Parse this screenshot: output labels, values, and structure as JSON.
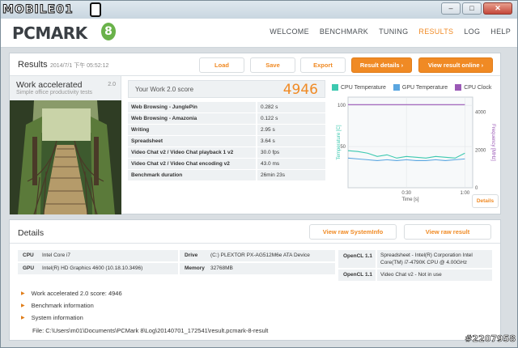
{
  "watermark_top": "MOBILE01",
  "watermark_bottom": "#2207958",
  "window": {
    "min": "–",
    "max": "□",
    "close": "✕"
  },
  "header": {
    "logo": "PCMARK",
    "logo_badge": "8",
    "nav": [
      "WELCOME",
      "BENCHMARK",
      "TUNING",
      "RESULTS",
      "LOG",
      "HELP"
    ],
    "active_nav": "RESULTS"
  },
  "results": {
    "title": "Results",
    "date": "2014/7/1 下午 05:52:12",
    "buttons": {
      "load": "Load",
      "save": "Save",
      "export": "Export",
      "details": "Result details",
      "online": "View result online"
    },
    "work": {
      "title": "Work accelerated",
      "version": "2.0",
      "subtitle": "Simple office productivity tests"
    },
    "score_label": "Your Work 2.0 score",
    "score": "4946",
    "rows": [
      {
        "k": "Web Browsing - JunglePin",
        "v": "0.282 s"
      },
      {
        "k": "Web Browsing - Amazonia",
        "v": "0.122 s"
      },
      {
        "k": "Writing",
        "v": "2.95 s"
      },
      {
        "k": "Spreadsheet",
        "v": "3.64 s"
      },
      {
        "k": "Video Chat v2 / Video Chat playback 1 v2",
        "v": "30.0 fps"
      },
      {
        "k": "Video Chat v2 / Video Chat encoding v2",
        "v": "43.0 ms"
      },
      {
        "k": "Benchmark duration",
        "v": "26min 23s"
      }
    ],
    "details_small": "Details"
  },
  "chart_data": {
    "type": "line",
    "legend": [
      "CPU Temperature",
      "GPU Temperature",
      "CPU Clock"
    ],
    "ylabel_left": "Temperature [C]",
    "ylabel_right": "Frequency [MHz]",
    "xlabel": "Time [s]",
    "x_ticks": [
      "0:30",
      "1:00"
    ],
    "y_left_ticks": [
      "100",
      "50"
    ],
    "y_right_ticks": [
      "4000",
      "2000",
      "0"
    ],
    "x": [
      0,
      5,
      10,
      15,
      20,
      25,
      30,
      35,
      40,
      45,
      50,
      55,
      60
    ],
    "series": [
      {
        "name": "CPU Temperature",
        "color": "#3dc9b0",
        "values": [
          45,
          44,
          42,
          38,
          40,
          36,
          38,
          37,
          36,
          38,
          37,
          36,
          42
        ]
      },
      {
        "name": "GPU Temperature",
        "color": "#5aa6e0",
        "values": [
          36,
          35,
          34,
          33,
          34,
          33,
          34,
          33,
          33,
          34,
          33,
          34,
          35
        ]
      },
      {
        "name": "CPU Clock",
        "color": "#9b59b6",
        "values": [
          4400,
          4400,
          4400,
          4400,
          4400,
          4400,
          4400,
          4400,
          4400,
          4400,
          4400,
          4400,
          4400
        ]
      }
    ],
    "ylim_left": [
      0,
      110
    ],
    "ylim_right": [
      0,
      4800
    ],
    "xlim": [
      0,
      64
    ]
  },
  "details": {
    "title": "Details",
    "btn_systeminfo": "View raw SystemInfo",
    "btn_raw": "View raw result",
    "cpu_k": "CPU",
    "cpu_v": "Intel Core i7",
    "gpu_k": "GPU",
    "gpu_v": "Intel(R) HD Graphics 4600 (10.18.10.3496)",
    "drive_k": "Drive",
    "drive_v": "(C:) PLEXTOR PX-AG512M6e ATA Device",
    "mem_k": "Memory",
    "mem_v": "32768MB",
    "ocl1_k": "OpenCL 1.1",
    "ocl1_v": "Spreadsheet - Intel(R) Corporation Intel Core(TM) i7-4790K CPU @ 4.00GHz",
    "ocl2_k": "OpenCL 1.1",
    "ocl2_v": "Video Chat v2 - Not in use",
    "acc1": "Work accelerated 2.0 score: 4946",
    "acc2": "Benchmark information",
    "acc3": "System information",
    "file": "File: C:\\Users\\m01\\Documents\\PCMark 8\\Log\\20140701_172541\\result.pcmark-8-result"
  }
}
